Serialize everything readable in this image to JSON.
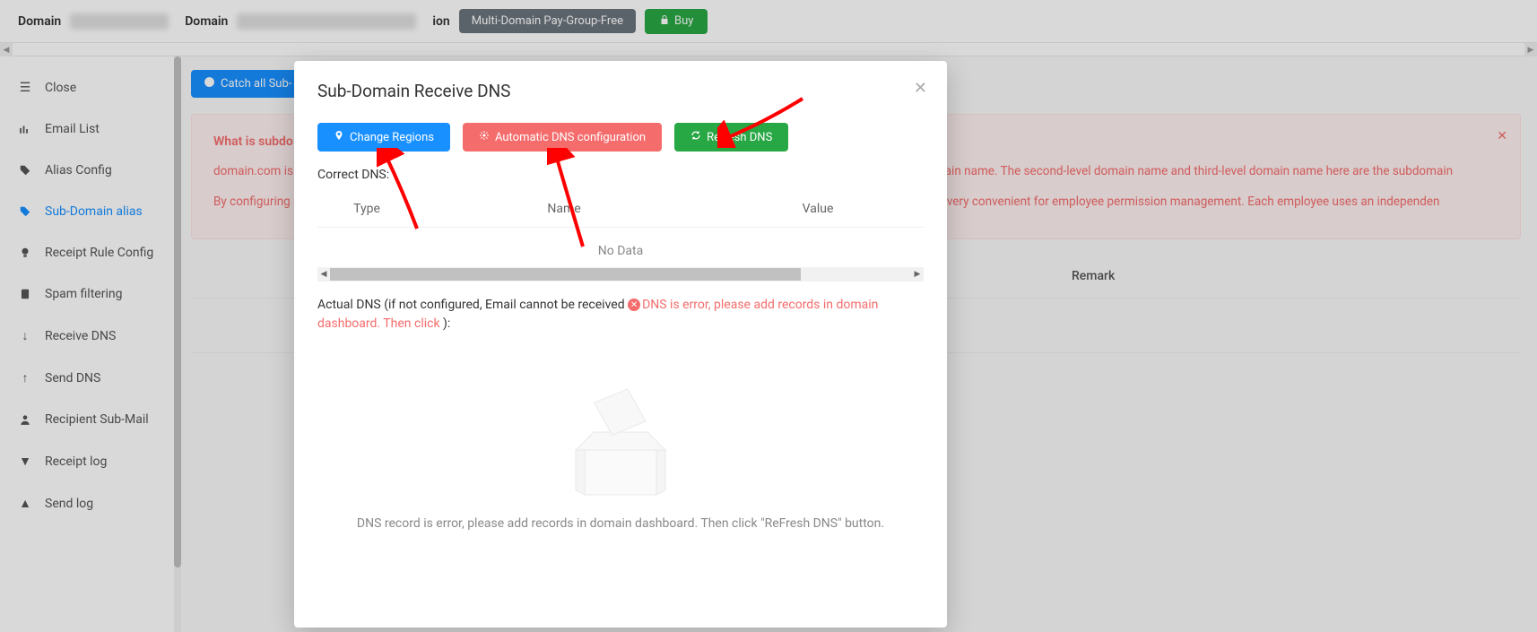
{
  "header": {
    "domain_label": "Domain",
    "domain_label2": "Domain",
    "badge_label": "Multi-Domain Pay-Group-Free",
    "buy_label": "Buy"
  },
  "sidebar": {
    "items": [
      {
        "label": "Close",
        "icon": "close"
      },
      {
        "label": "Email List",
        "icon": "bars"
      },
      {
        "label": "Alias Config",
        "icon": "tag"
      },
      {
        "label": "Sub-Domain alias",
        "icon": "tag",
        "active": true
      },
      {
        "label": "Receipt Rule Config",
        "icon": "bulb"
      },
      {
        "label": "Spam filtering",
        "icon": "clipboard"
      },
      {
        "label": "Receive DNS",
        "icon": "down"
      },
      {
        "label": "Send DNS",
        "icon": "up"
      },
      {
        "label": "Recipient Sub-Mail",
        "icon": "user"
      },
      {
        "label": "Receipt log",
        "icon": "caret-down"
      },
      {
        "label": "Send log",
        "icon": "caret-up"
      }
    ]
  },
  "content": {
    "catch_btn": "Catch all Sub-",
    "info": {
      "title": "What is subdo",
      "p1a": "domain.com is",
      "p1b": "ain name. The second-level domain name and third-level domain name here are the subdomain",
      "p2a": "By configuring",
      "p2b": "s very convenient for employee permission management. Each employee uses an independen"
    },
    "bg_col_remark": "Remark"
  },
  "modal": {
    "title": "Sub-Domain Receive DNS",
    "btn_change_regions": "Change Regions",
    "btn_auto_dns": "Automatic DNS configuration",
    "btn_refresh_dns": "Refresh DNS",
    "correct_dns_label": "Correct DNS:",
    "table": {
      "col_type": "Type",
      "col_name": "Name",
      "col_value": "Value",
      "no_data": "No Data"
    },
    "actual_dns_prefix": "Actual DNS (if not configured, Email cannot be received ",
    "actual_dns_error": "DNS is error, please add records in domain dashboard. Then click ",
    "actual_dns_suffix": "):",
    "empty_footer": "DNS record is error, please add records in domain dashboard. Then click \"ReFresh DNS\" button."
  }
}
